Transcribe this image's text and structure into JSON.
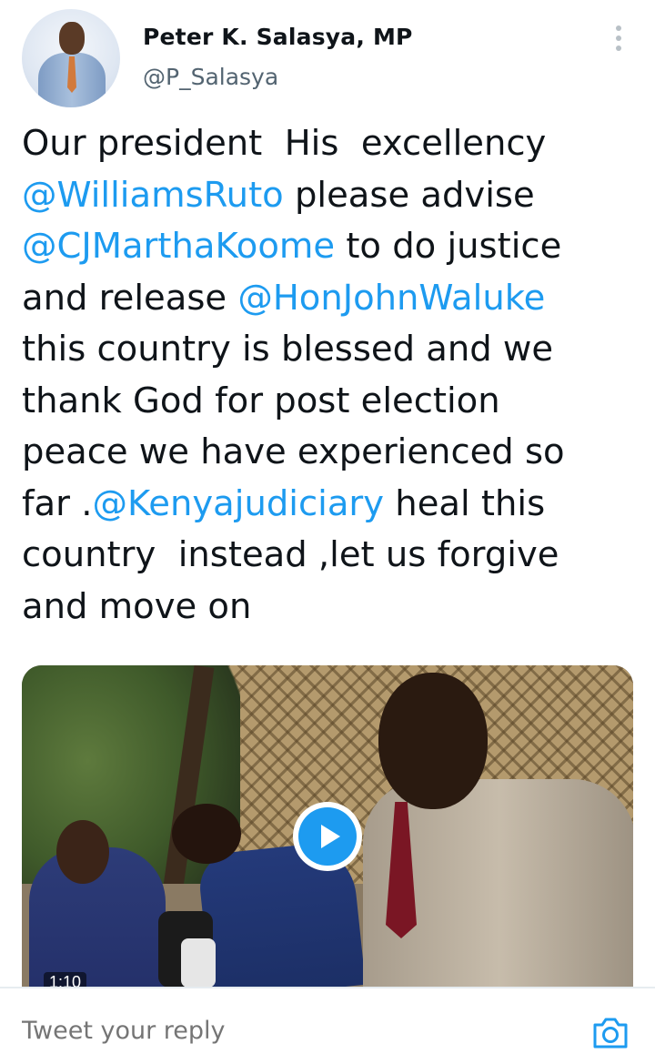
{
  "author": {
    "display_name": "Peter K. Salasya, MP",
    "handle": "@P_Salasya",
    "avatar_icon": "profile-photo"
  },
  "tweet": {
    "lines": [
      [
        {
          "t": "Our president  His  excellency",
          "m": false
        }
      ],
      [
        {
          "t": "@WilliamsRuto",
          "m": true
        },
        {
          "t": " please advise",
          "m": false
        }
      ],
      [
        {
          "t": "@CJMarthaKoome",
          "m": true
        },
        {
          "t": " to do justice",
          "m": false
        }
      ],
      [
        {
          "t": "and release ",
          "m": false
        },
        {
          "t": "@HonJohnWaluke",
          "m": true
        }
      ],
      [
        {
          "t": "this country is blessed and we",
          "m": false
        }
      ],
      [
        {
          "t": "thank God for post election",
          "m": false
        }
      ],
      [
        {
          "t": "peace we have experienced so",
          "m": false
        }
      ],
      [
        {
          "t": "far .",
          "m": false
        },
        {
          "t": "@Kenyajudiciary",
          "m": true
        },
        {
          "t": " heal this",
          "m": false
        }
      ],
      [
        {
          "t": "country  instead ,let us forgive",
          "m": false
        }
      ],
      [
        {
          "t": "and move on",
          "m": false
        }
      ]
    ]
  },
  "media": {
    "duration": "1:10",
    "play_icon": "play-icon"
  },
  "reply": {
    "placeholder": "Tweet your reply",
    "camera_icon": "camera-icon"
  },
  "colors": {
    "mention": "#1d9bf0",
    "handle": "#536471",
    "text": "#0f1419"
  }
}
